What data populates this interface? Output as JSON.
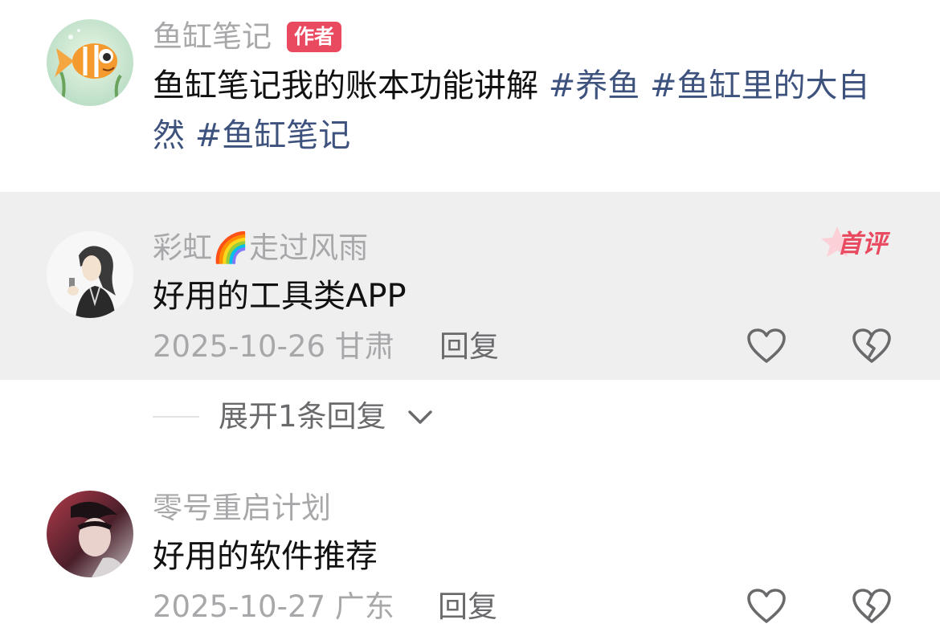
{
  "post": {
    "author_name": "鱼缸笔记",
    "author_badge": "作者",
    "text": "鱼缸笔记我的账本功能讲解",
    "tags": [
      "#养鱼",
      "#鱼缸里的大自然",
      "#鱼缸笔记"
    ]
  },
  "comments": [
    {
      "username": "彩虹🌈走过风雨",
      "text": "好用的工具类APP",
      "date": "2025-10-26",
      "location": "甘肃",
      "reply_label": "回复",
      "first_badge": "首评",
      "highlighted": true
    },
    {
      "username": "零号重启计划",
      "text": "好用的软件推荐",
      "date": "2025-10-27",
      "location": "广东",
      "reply_label": "回复",
      "highlighted": false
    }
  ],
  "expand_replies": {
    "label": "展开1条回复"
  },
  "colors": {
    "tag": "#3e527e",
    "badge": "#ea4a60",
    "highlight_bg": "#efeff0",
    "muted_text": "#a8a8ab"
  },
  "icons": [
    "heart-outline-icon",
    "broken-heart-icon",
    "chevron-down-icon"
  ]
}
